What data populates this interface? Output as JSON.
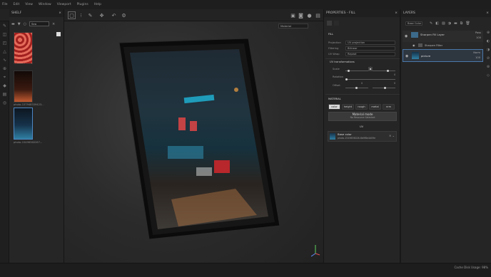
{
  "menu": [
    "File",
    "Edit",
    "View",
    "Window",
    "Viewport",
    "Plugins",
    "Help"
  ],
  "shelf": {
    "title": "SHELF",
    "search_value": "Sea",
    "thumbs": [
      {
        "label": "",
        "color": "#b8342f"
      },
      {
        "label": "photo-157948339423...",
        "color": "#3b1a10"
      },
      {
        "label": "photo-15496360267...",
        "color": "#16324a"
      }
    ]
  },
  "viewport": {
    "mode": "Material"
  },
  "properties": {
    "title": "PROPERTIES - FILL",
    "section_fill": "FILL",
    "projection_label": "Projection",
    "projection_value": "UV projection",
    "filtering_label": "Filtering",
    "filtering_value": "Bilinear",
    "uvwrap_label": "UV Wrap",
    "uvwrap_value": "Repeat",
    "uv_transform": "UV transformations",
    "scale_label": "Scale",
    "rotation_label": "Rotation",
    "offset_label": "Offset",
    "scale_val": "1",
    "rotation_val": "0",
    "offset_x": "0",
    "offset_y": "0",
    "material_section": "MATERIAL",
    "channels": [
      "color",
      "height",
      "rough",
      "metal",
      "nrm"
    ],
    "material_mode_title": "Material mode",
    "material_mode_sub": "No Resource Selected",
    "uv_label": "UV",
    "base_color_title": "Base color",
    "base_color_sub": "photo-1549636026-6b9f8e4d09e"
  },
  "layers": {
    "title": "LAYERS",
    "blend": "Base Color",
    "items": [
      {
        "name": "Sharpen Fill Layer",
        "opacity": "Pass",
        "value": "100"
      },
      {
        "name": "Sharpen Filter",
        "opacity": "",
        "value": ""
      },
      {
        "name": "picture",
        "opacity": "Norm",
        "value": "100"
      }
    ]
  },
  "status": {
    "text": "Cache Disk Usage: 98%"
  }
}
